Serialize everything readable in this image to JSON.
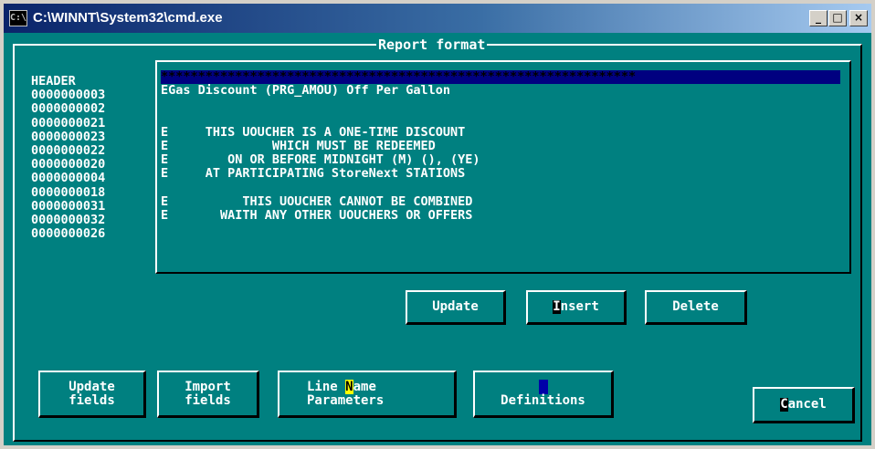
{
  "window": {
    "title": "C:\\WINNT\\System32\\cmd.exe",
    "icon_text": "C:\\",
    "minimize": "_",
    "maximize": "□",
    "close": "×"
  },
  "dialog": {
    "title": "Report format"
  },
  "codes": [
    "HEADER",
    "0000000003",
    "0000000002",
    "0000000021",
    "0000000023",
    "0000000022",
    "0000000020",
    "0000000004",
    "0000000018",
    "0000000031",
    "0000000032",
    "0000000026"
  ],
  "lines": [
    "****************************************************************",
    "EGas Discount (PRG_AMOU) Off Per Gallon",
    "",
    "",
    "E     THIS UOUCHER IS A ONE-TIME DISCOUNT",
    "E              WHICH MUST BE REDEEMED",
    "E        ON OR BEFORE MIDNIGHT (M) (), (YE)",
    "E     AT PARTICIPATING StoreNext STATIONS",
    "",
    "E          THIS UOUCHER CANNOT BE COMBINED",
    "E       WAITH ANY OTHER UOUCHERS OR OFFERS",
    ""
  ],
  "buttons": {
    "update": "Update",
    "insert_hotkey": "I",
    "insert_rest": "nsert",
    "delete": "Delete",
    "update_fields_1": "Update",
    "update_fields_2": "fields",
    "import_fields_1": "Import",
    "import_fields_2": "fields",
    "line_name_pre": "Line ",
    "line_name_hotkey": "N",
    "line_name_post": "ame",
    "line_name_2": "Parameters",
    "definitions": "Definitions",
    "cancel_hotkey": "C",
    "cancel_rest": "ancel"
  },
  "colors": {
    "console_bg": "#008080",
    "selection": "#000080",
    "title_gradient_start": "#0a246a",
    "hotkey_yellow": "#ffff00"
  }
}
